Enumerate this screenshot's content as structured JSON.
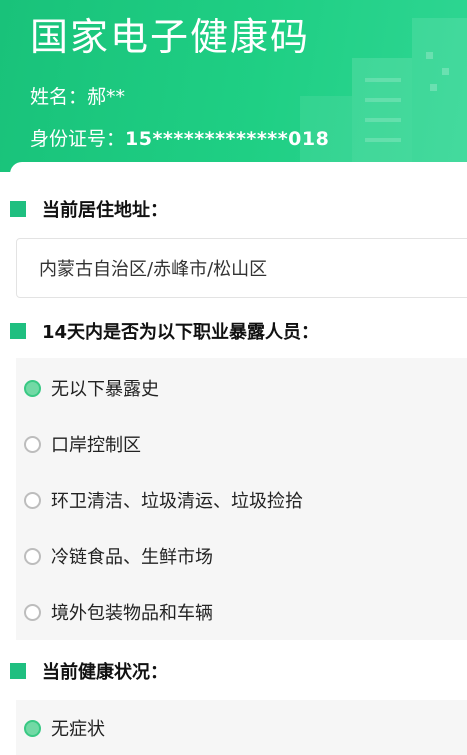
{
  "header": {
    "title": "国家电子健康码",
    "name_label": "姓名：",
    "name_value": "郝**",
    "id_label": "身份证号：",
    "id_value": "15*************018",
    "accent_color": "#1fc07e"
  },
  "address_section": {
    "title": "当前居住地址：",
    "value": "内蒙古自治区/赤峰市/松山区"
  },
  "exposure_section": {
    "title": "14天内是否为以下职业暴露人员：",
    "options": [
      {
        "label": "无以下暴露史",
        "selected": true
      },
      {
        "label": "口岸控制区",
        "selected": false
      },
      {
        "label": "环卫清洁、垃圾清运、垃圾捡拾",
        "selected": false
      },
      {
        "label": "冷链食品、生鲜市场",
        "selected": false
      },
      {
        "label": "境外包装物品和车辆",
        "selected": false
      }
    ]
  },
  "health_section": {
    "title": "当前健康状况：",
    "options": [
      {
        "label": "无症状",
        "selected": true
      }
    ]
  }
}
